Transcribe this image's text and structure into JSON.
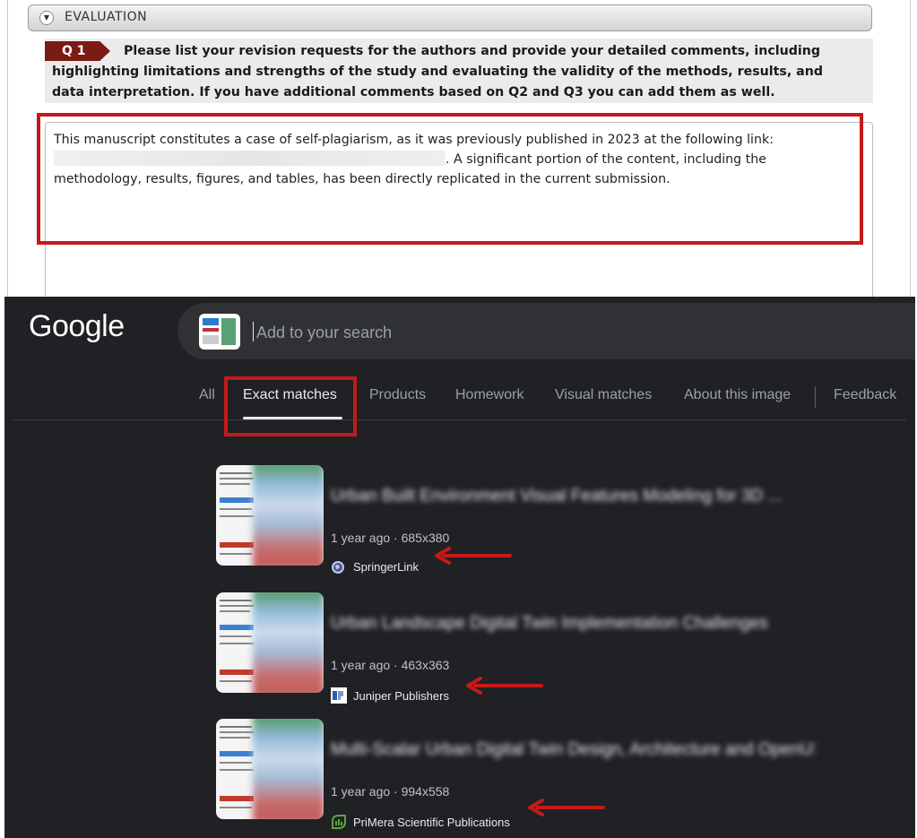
{
  "review": {
    "section_title": "EVALUATION",
    "question_badge": "Q 1",
    "question_text": "Please list your revision requests for the authors and provide your detailed comments, including highlighting limitations and strengths of the study and evaluating the validity of the methods, results, and data interpretation. If you have additional comments based on Q2 and Q3 you can add them as well.",
    "answer_part1": "This manuscript constitutes a case of self-plagiarism, as it was previously published in 2023 at the following link:",
    "answer_part2": ". A significant portion of the content, including the methodology, results, figures, and tables, has been directly replicated in the current submission."
  },
  "google": {
    "logo": "Google",
    "search_placeholder": "Add to your search",
    "tabs": [
      "All",
      "Exact matches",
      "Products",
      "Homework",
      "Visual matches",
      "About this image",
      "Feedback"
    ],
    "active_tab": "Exact matches",
    "results": [
      {
        "title": "Urban Built Environment Visual Features Modeling for 3D ...",
        "meta": "1 year ago · 685x380",
        "source": "SpringerLink",
        "icon": "globe-icon"
      },
      {
        "title": "Urban Landscape Digital Twin Implementation Challenges",
        "meta": "1 year ago · 463x363",
        "source": "Juniper Publishers",
        "icon": "jp-logo-icon"
      },
      {
        "title": "Multi-Scalar Urban Digital Twin Design, Architecture and OpenUSD ...",
        "meta": "1 year ago · 994x558",
        "source": "PriMera Scientific Publications",
        "icon": "primera-logo-icon"
      }
    ]
  },
  "colors": {
    "highlight_red": "#c41a1a",
    "badge_maroon": "#7a1b14",
    "google_bg": "#202124",
    "google_text": "#e8eaed",
    "google_muted": "#9aa0a6"
  }
}
